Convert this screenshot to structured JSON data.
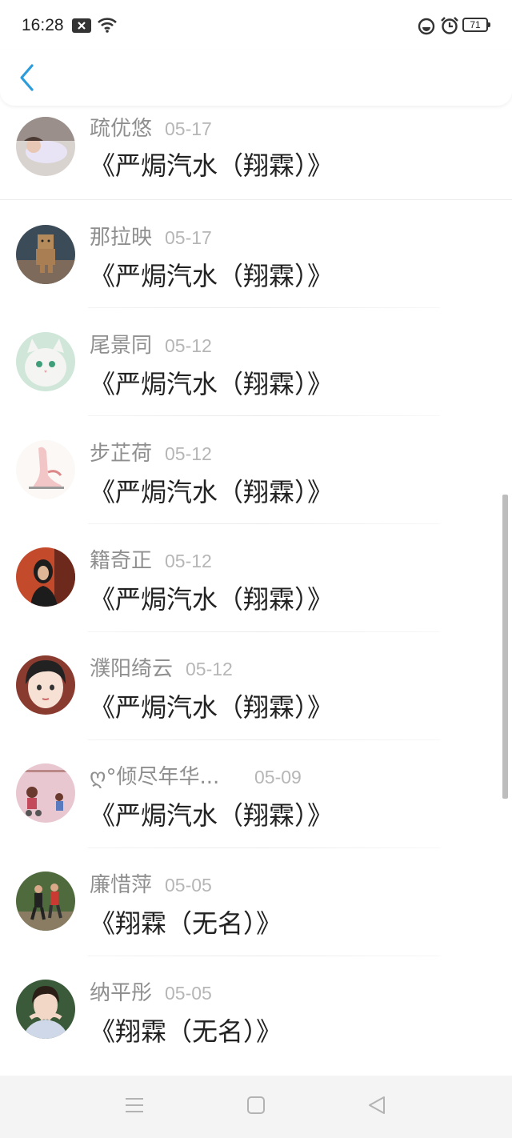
{
  "status_bar": {
    "time": "16:28",
    "battery": "71",
    "icons": [
      "notification-x-icon",
      "wifi-icon",
      "dnd-icon",
      "alarm-icon",
      "battery-icon"
    ]
  },
  "header": {
    "back_icon": "chevron-left-icon",
    "accent_color": "#2d9cdb"
  },
  "comments": [
    {
      "name": "疏优悠",
      "date": "05-17",
      "title": "《严焗汽水（翔霖）》"
    },
    {
      "name": "那拉映",
      "date": "05-17",
      "title": "《严焗汽水（翔霖）》"
    },
    {
      "name": "尾景同",
      "date": "05-12",
      "title": "《严焗汽水（翔霖）》"
    },
    {
      "name": "步芷荷",
      "date": "05-12",
      "title": "《严焗汽水（翔霖）》"
    },
    {
      "name": "籍奇正",
      "date": "05-12",
      "title": "《严焗汽水（翔霖）》"
    },
    {
      "name": "濮阳绮云",
      "date": "05-12",
      "title": "《严焗汽水（翔霖）》"
    },
    {
      "name": "ღ°倾尽年华...",
      "date": "05-09",
      "title": "《严焗汽水（翔霖）》"
    },
    {
      "name": "廉惜萍",
      "date": "05-05",
      "title": "《翔霖（无名）》"
    },
    {
      "name": "纳平彤",
      "date": "05-05",
      "title": "《翔霖（无名）》"
    }
  ],
  "nav_bar": {
    "icons": [
      "menu-icon",
      "home-square-icon",
      "back-triangle-icon"
    ]
  }
}
